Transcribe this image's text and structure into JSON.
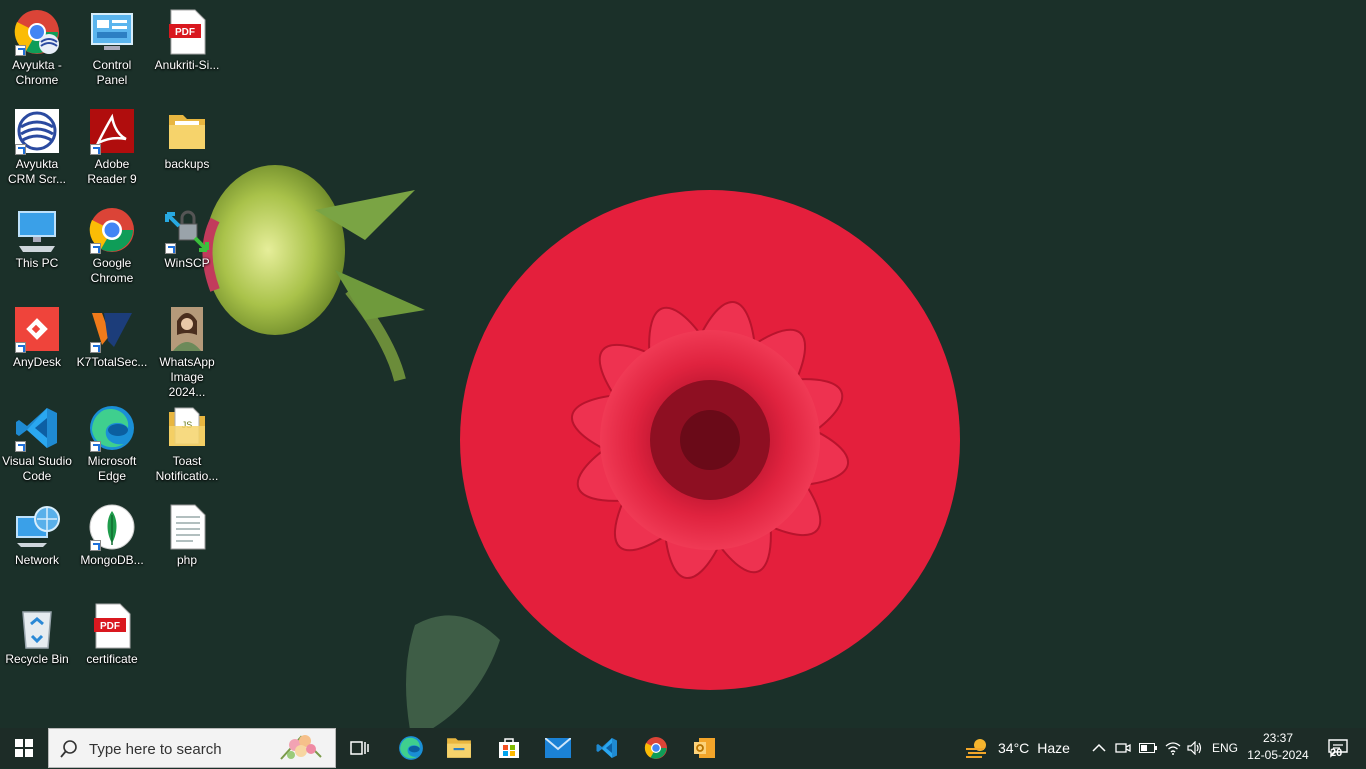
{
  "desktop": {
    "icons": [
      {
        "label": "Avyukta - Chrome"
      },
      {
        "label": "Control Panel"
      },
      {
        "label": "Anukriti-Si..."
      },
      {
        "label": "Avyukta CRM Scr..."
      },
      {
        "label": "Adobe Reader 9"
      },
      {
        "label": "backups"
      },
      {
        "label": "This PC"
      },
      {
        "label": "Google Chrome"
      },
      {
        "label": "WinSCP"
      },
      {
        "label": "AnyDesk"
      },
      {
        "label": "K7TotalSec..."
      },
      {
        "label": "WhatsApp Image 2024..."
      },
      {
        "label": "Visual Studio Code"
      },
      {
        "label": "Microsoft Edge"
      },
      {
        "label": "Toast Notificatio..."
      },
      {
        "label": "Network"
      },
      {
        "label": "MongoDB..."
      },
      {
        "label": "php"
      },
      {
        "label": "Recycle Bin"
      },
      {
        "label": "certificate"
      }
    ]
  },
  "taskbar": {
    "search_placeholder": "Type here to search",
    "pinned": [
      "task-view",
      "microsoft-edge",
      "file-explorer",
      "microsoft-store",
      "mail",
      "visual-studio-code",
      "google-chrome",
      "outlook"
    ],
    "weather": {
      "temp": "34°C",
      "condition": "Haze"
    },
    "language": "ENG",
    "time": "23:37",
    "date": "12-05-2024",
    "notification_count": "20"
  },
  "colors": {
    "desktop_bg": "#1b3029",
    "taskbar_bg": "#1d2c27",
    "flower_red": "#e0233f"
  }
}
